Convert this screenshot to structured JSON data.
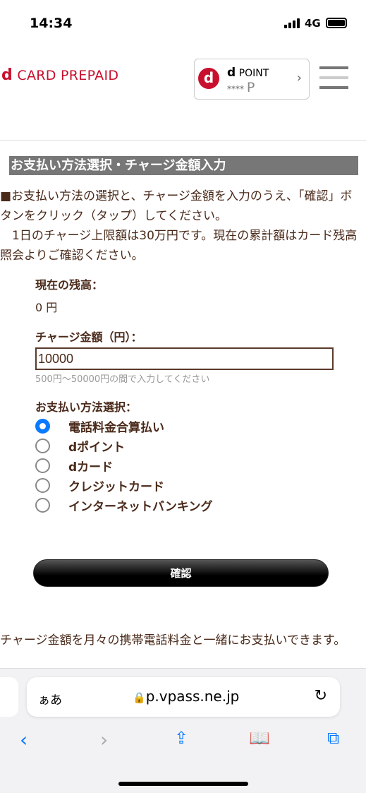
{
  "status_bar": {
    "time": "14:34",
    "network": "4G"
  },
  "header": {
    "logo_d": "d",
    "logo_text": "CARD PREPAID",
    "dpoint": {
      "d": "d",
      "label": "POINT",
      "masked": "****",
      "unit": "P"
    }
  },
  "section_title": "お支払い方法選択・チャージ金額入力",
  "intro": [
    "■お支払い方法の選択と、チャージ金額を入力のうえ、「確認」ボタンをクリック（タップ）してください。",
    "　1日のチャージ上限額は30万円です。現在の累計額はカード残高照会よりご確認ください。"
  ],
  "balance": {
    "label": "現在の残高：",
    "value": "0 円"
  },
  "charge": {
    "label": "チャージ金額（円）：",
    "value": "10000",
    "hint": "500円～50000円の間で入力してください"
  },
  "payment": {
    "label": "お支払い方法選択：",
    "options": [
      {
        "label": "電話料金合算払い",
        "selected": true
      },
      {
        "label": "dポイント",
        "selected": false
      },
      {
        "label": "dカード",
        "selected": false
      },
      {
        "label": "クレジットカード",
        "selected": false
      },
      {
        "label": "インターネットバンキング",
        "selected": false
      }
    ]
  },
  "confirm_button": "確認",
  "footer_text": "チャージ金額を月々の携帯電話料金と一緒にお支払いできます。",
  "browser": {
    "aa": "ぁあ",
    "url": "p.vpass.ne.jp"
  },
  "colors": {
    "brand": "#c8102e",
    "text": "#4a2a1a",
    "accent": "#0a7aff"
  }
}
